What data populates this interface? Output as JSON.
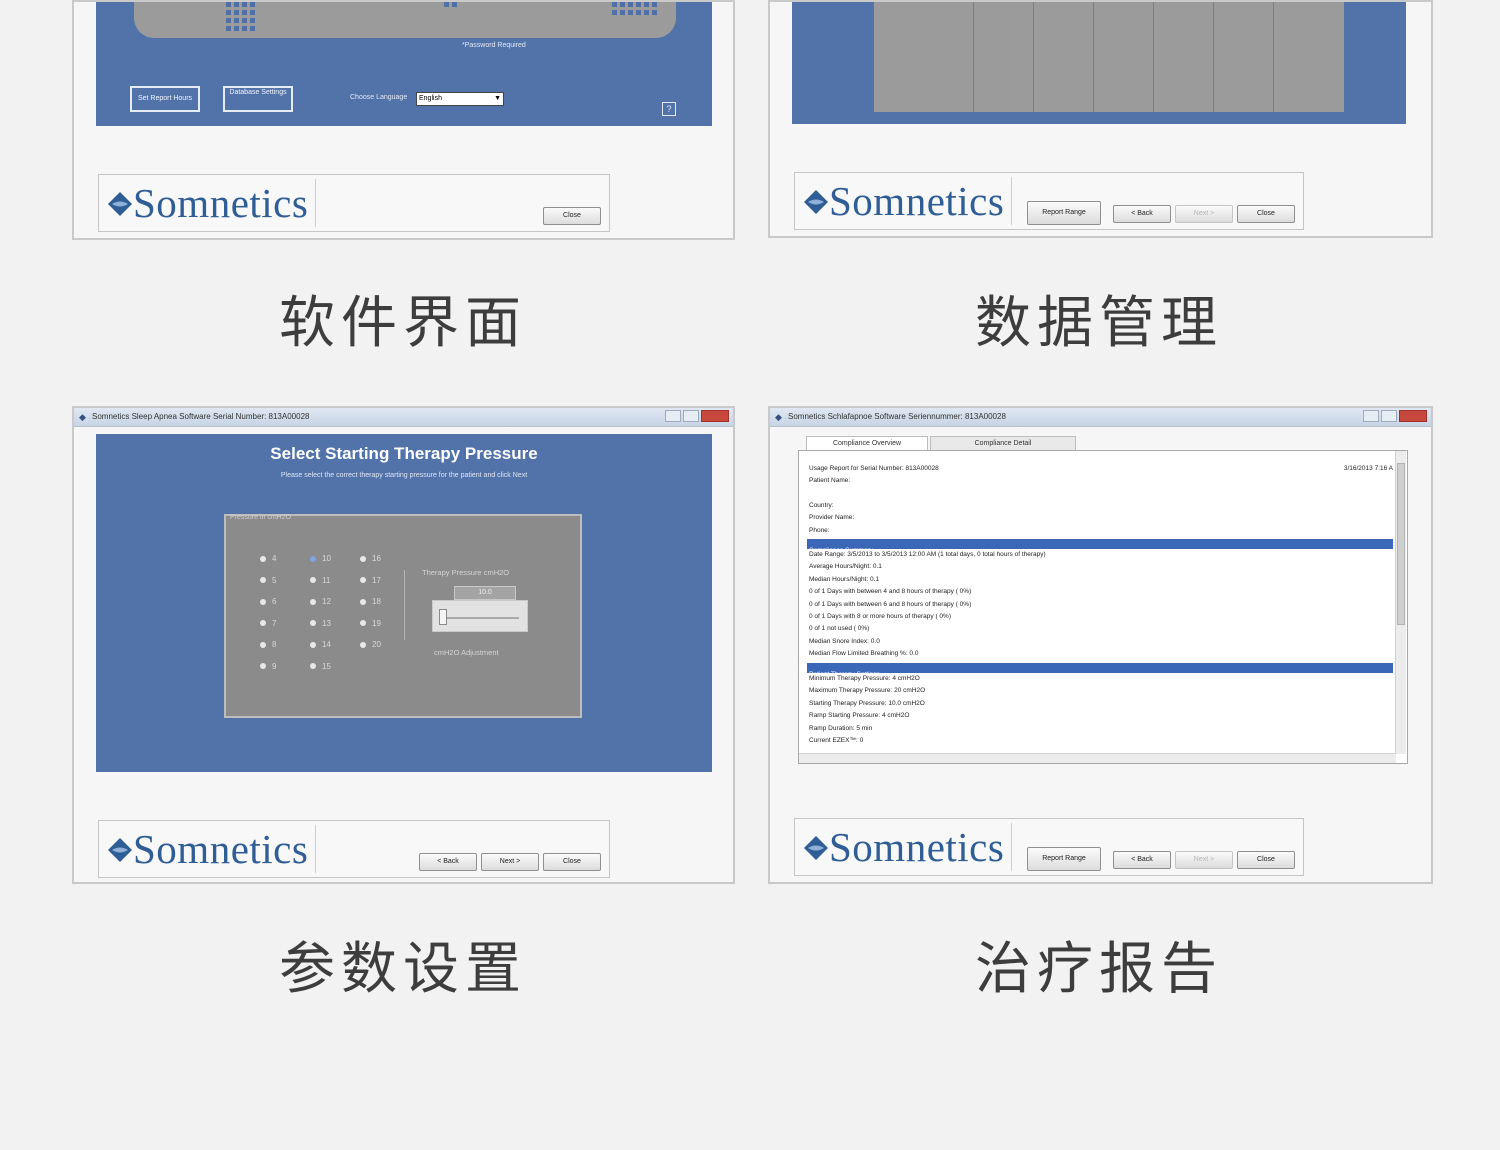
{
  "brand": "Somnetics",
  "colors": {
    "screen_blue": "#5272aa",
    "logo_blue": "#2f5d95",
    "highlight": "#3b67b8"
  },
  "captions": {
    "software_ui": "软件界面",
    "data_management": "数据管理",
    "parameter_settings": "参数设置",
    "therapy_report": "治疗报告"
  },
  "panel1": {
    "password_note": "*Password Required",
    "set_report_hours_button": "Set Report Hours",
    "database_settings_button": "Database Settings",
    "language_label": "Choose Language",
    "language_value": "English",
    "help_icon": "help-icon",
    "close_button": "Close"
  },
  "panel2": {
    "report_range_button": "Report Range",
    "back_button": "< Back",
    "next_button": "Next >",
    "close_button": "Close"
  },
  "panel3": {
    "window_title": "Somnetics Sleep Apnea Software    Serial Number: 813A00028",
    "heading": "Select Starting Therapy Pressure",
    "instruction": "Please select the correct therapy starting pressure for the patient and click Next",
    "group_label": "Pressure in cmH2O",
    "pressures_col1": [
      "4",
      "5",
      "6",
      "7",
      "8",
      "9"
    ],
    "pressures_col2": [
      "10",
      "11",
      "12",
      "13",
      "14",
      "15"
    ],
    "pressures_col3": [
      "16",
      "17",
      "18",
      "19",
      "20"
    ],
    "selected_pressure": "10",
    "therapy_pressure_label": "Therapy Pressure cmH2O",
    "therapy_pressure_value": "10.0",
    "adjustment_label": "cmH2O Adjustment",
    "back_button": "< Back",
    "next_button": "Next >",
    "close_button": "Close"
  },
  "panel4": {
    "window_title": "Somnetics Schlafapnoe Software    Seriennummer: 813A00028",
    "tabs": [
      "Compliance Overview",
      "Compliance Detail"
    ],
    "active_tab": "Compliance Overview",
    "report_title": "Usage Report for Serial Number: 813A00028",
    "report_date": "3/16/2013 7:16 A",
    "patient_lines": [
      "Patient Name:",
      "",
      "Country:",
      "Provider Name:",
      "Phone:"
    ],
    "section_compliance": "Compliance Summary",
    "compliance_lines": [
      "Date Range: 3/5/2013 to 3/5/2013 12:00 AM (1 total days, 0 total hours of therapy)",
      "Average Hours/Night:   0.1",
      "Median Hours/Night:   0.1",
      "0 of 1 Days with between 4 and 8 hours of therapy ( 0%)",
      "0 of 1 Days with between 6 and 8 hours of therapy ( 0%)",
      "0 of 1 Days with 8 or more hours of therapy ( 0%)",
      "0 of 1 not used ( 0%)",
      "Median Snore Index:   0.0",
      "Median Flow Limited Breathing %:   0.0"
    ],
    "section_settings": "Patient Therapy Settings",
    "settings_lines": [
      "Minimum Therapy Pressure: 4 cmH2O",
      "Maximum Therapy Pressure: 20 cmH2O",
      "Starting Therapy Pressure: 10.0 cmH2O",
      "Ramp Starting Pressure: 4 cmH2O",
      "Ramp Duration: 5 min",
      "Current EZEX™: 0"
    ],
    "report_range_button": "Report Range",
    "back_button": "< Back",
    "next_button": "Next >",
    "close_button": "Close"
  }
}
